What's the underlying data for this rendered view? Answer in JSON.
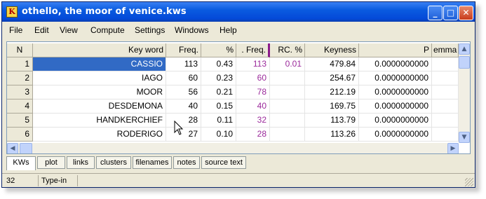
{
  "window": {
    "title": "othello, the moor of venice.kws",
    "app_icon_glyph": "K",
    "controls": {
      "minimize": "_",
      "maximize": "□",
      "close": "✕"
    },
    "titlebar_color": "#0a5be0",
    "close_color": "#c83c1c"
  },
  "menu": [
    "File",
    "Edit",
    "View",
    "Compute",
    "Settings",
    "Windows",
    "Help"
  ],
  "table": {
    "headers": {
      "n": "N",
      "keyword": "Key word",
      "freq": "Freq.",
      "pct": "%",
      "ref_freq": ". Freq.",
      "rc_pct": "RC. %",
      "keyness": "Keyness",
      "p": "P",
      "lemmas": "emma"
    },
    "rows": [
      {
        "n": "1",
        "keyword": "CASSIO",
        "freq": "113",
        "pct": "0.43",
        "ref_freq": "113",
        "rc_pct": "0.01",
        "keyness": "479.84",
        "p": "0.0000000000",
        "selected": true
      },
      {
        "n": "2",
        "keyword": "IAGO",
        "freq": "60",
        "pct": "0.23",
        "ref_freq": "60",
        "rc_pct": "",
        "keyness": "254.67",
        "p": "0.0000000000"
      },
      {
        "n": "3",
        "keyword": "MOOR",
        "freq": "56",
        "pct": "0.21",
        "ref_freq": "78",
        "rc_pct": "",
        "keyness": "212.19",
        "p": "0.0000000000"
      },
      {
        "n": "4",
        "keyword": "DESDEMONA",
        "freq": "40",
        "pct": "0.15",
        "ref_freq": "40",
        "rc_pct": "",
        "keyness": "169.75",
        "p": "0.0000000000"
      },
      {
        "n": "5",
        "keyword": "HANDKERCHIEF",
        "freq": "28",
        "pct": "0.11",
        "ref_freq": "32",
        "rc_pct": "",
        "keyness": "113.79",
        "p": "0.0000000000"
      },
      {
        "n": "6",
        "keyword": "RODERIGO",
        "freq": "27",
        "pct": "0.10",
        "ref_freq": "28",
        "rc_pct": "",
        "keyness": "113.26",
        "p": "0.0000000000"
      }
    ],
    "selection_color": "#316ac5",
    "ref_color": "#9b2a9b"
  },
  "scroll": {
    "up": "▲",
    "down": "▼",
    "left": "◀",
    "right": "▶"
  },
  "tabs": [
    "KWs",
    "plot",
    "links",
    "clusters",
    "filenames",
    "notes",
    "source text"
  ],
  "active_tab": "KWs",
  "status": {
    "count": "32",
    "mode": "Type-in"
  }
}
